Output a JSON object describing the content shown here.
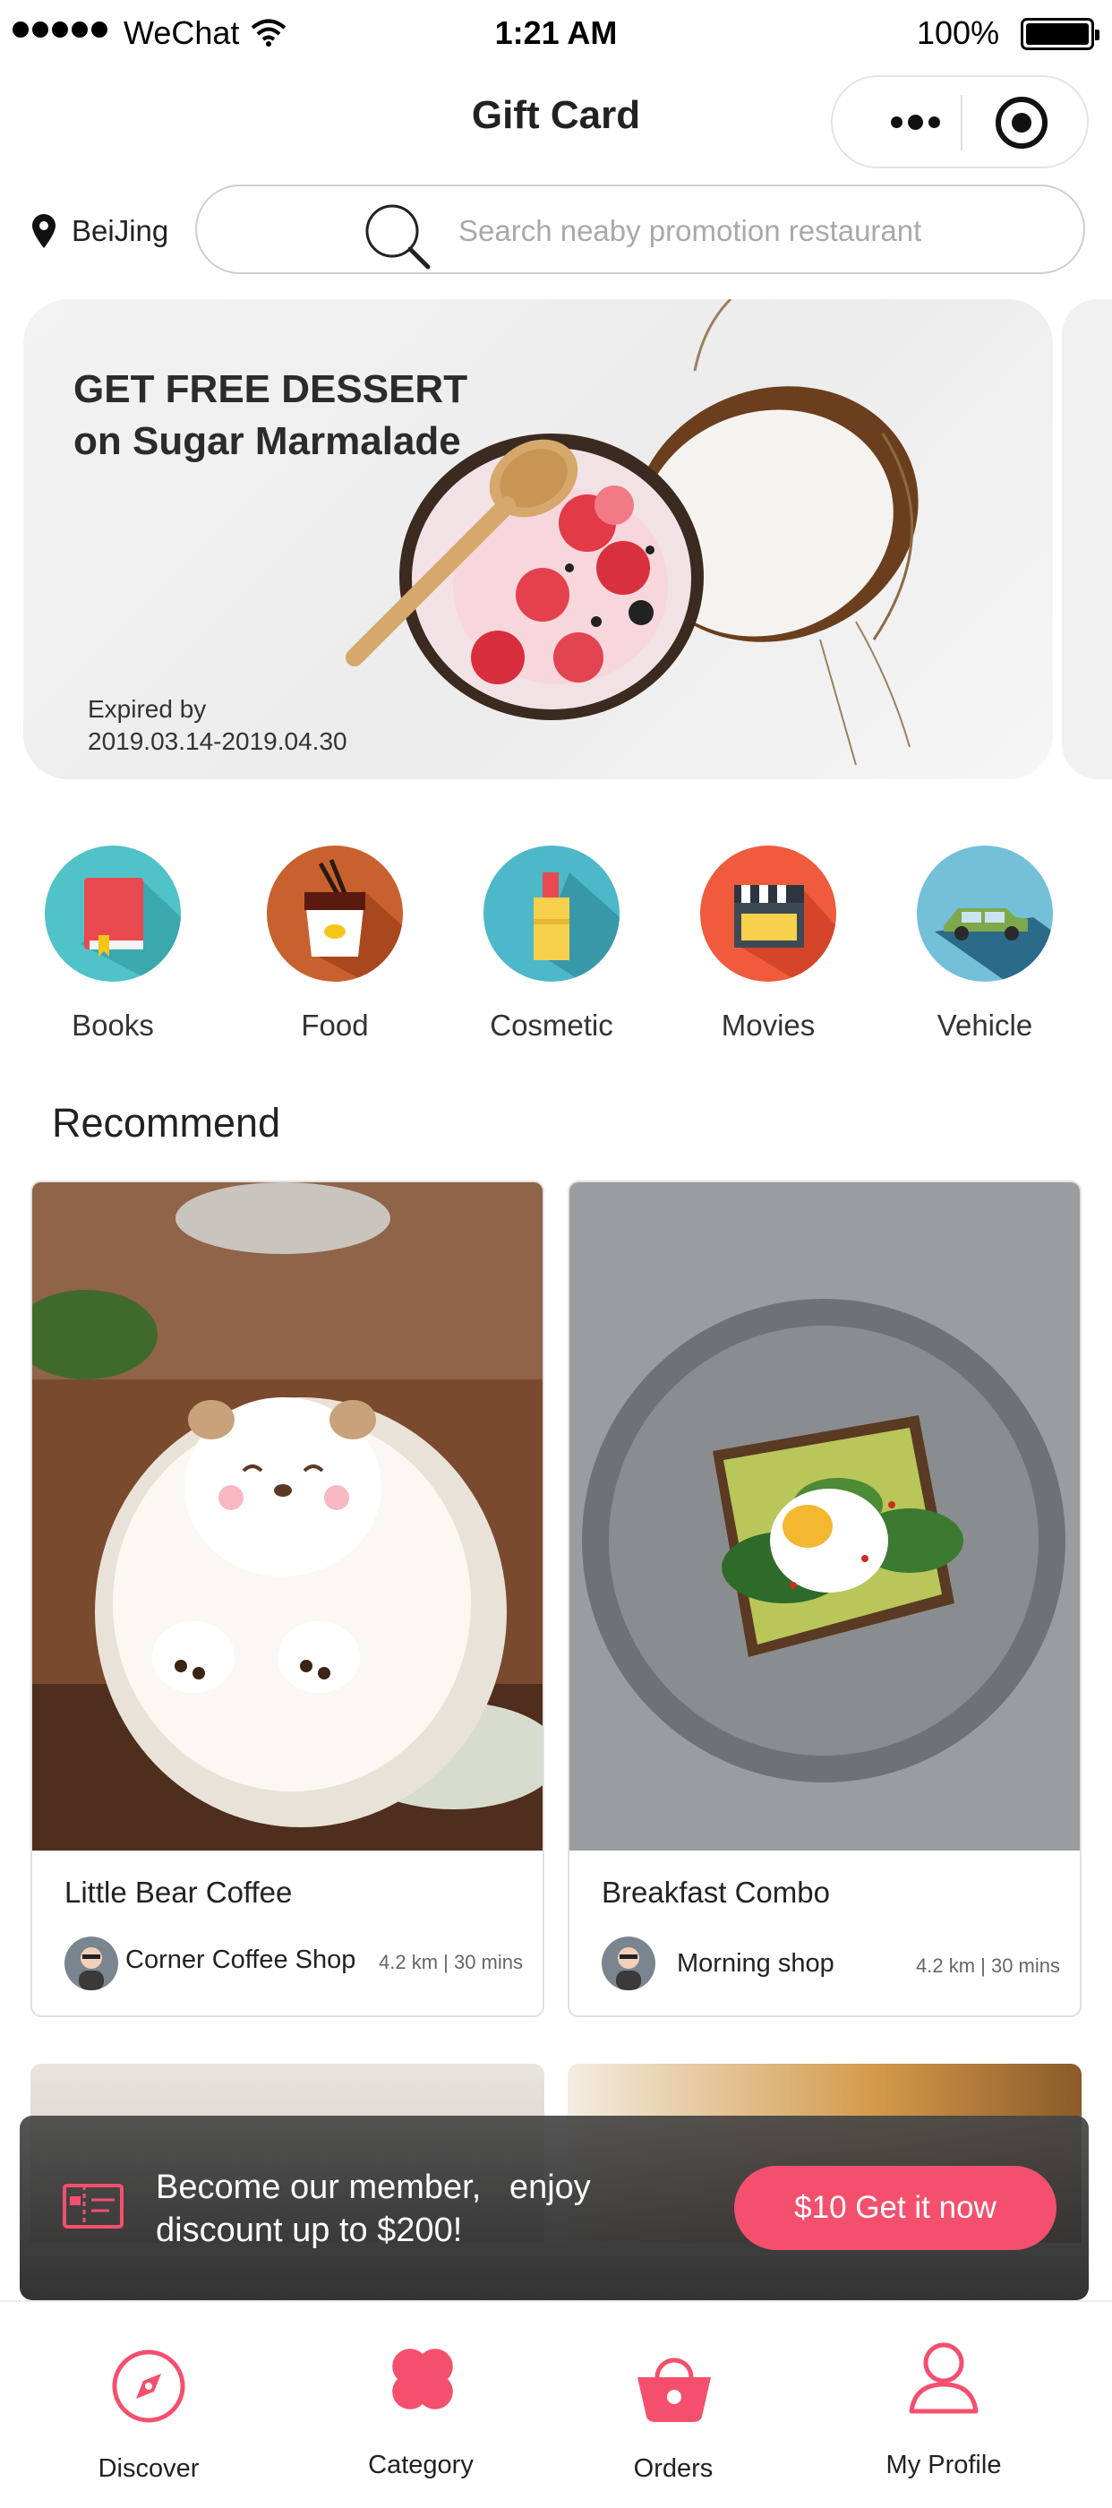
{
  "status": {
    "carrier": "WeChat",
    "time": "1:21 AM",
    "battery": "100%"
  },
  "nav": {
    "title": "Gift Card"
  },
  "location": {
    "city": "BeiJing"
  },
  "search": {
    "placeholder": "Search neaby promotion restaurant"
  },
  "banner": {
    "title_line1": "GET FREE DESSERT",
    "title_line2": "on Sugar Marmalade",
    "expiry_label": "Expired by",
    "expiry_dates": "2019.03.14-2019.04.30"
  },
  "categories": [
    {
      "label": "Books",
      "icon": "book-icon",
      "color": "#4fc3c8"
    },
    {
      "label": "Food",
      "icon": "noodle-box-icon",
      "color": "#c9612e"
    },
    {
      "label": "Cosmetic",
      "icon": "lipstick-icon",
      "color": "#4cb8c9"
    },
    {
      "label": "Movies",
      "icon": "clapperboard-icon",
      "color": "#ef5b3c"
    },
    {
      "label": "Vehicle",
      "icon": "car-icon",
      "color": "#74c0d8"
    }
  ],
  "recommend": {
    "title": "Recommend",
    "items": [
      {
        "name": "Little Bear Coffee",
        "shop": "Corner Coffee Shop",
        "meta": "4.2 km | 30 mins"
      },
      {
        "name": "Breakfast Combo",
        "shop": "Morning shop",
        "meta": "4.2 km | 30 mins"
      }
    ]
  },
  "member": {
    "line1": "Become our member,   enjoy",
    "line2": "discount up to $200!",
    "button": "$10 Get it now",
    "accent": "#f54f6e"
  },
  "tabs": [
    {
      "label": "Discover",
      "icon": "compass-icon"
    },
    {
      "label": "Category",
      "icon": "four-petal-icon"
    },
    {
      "label": "Orders",
      "icon": "basket-icon"
    },
    {
      "label": "My Profile",
      "icon": "person-icon"
    }
  ]
}
